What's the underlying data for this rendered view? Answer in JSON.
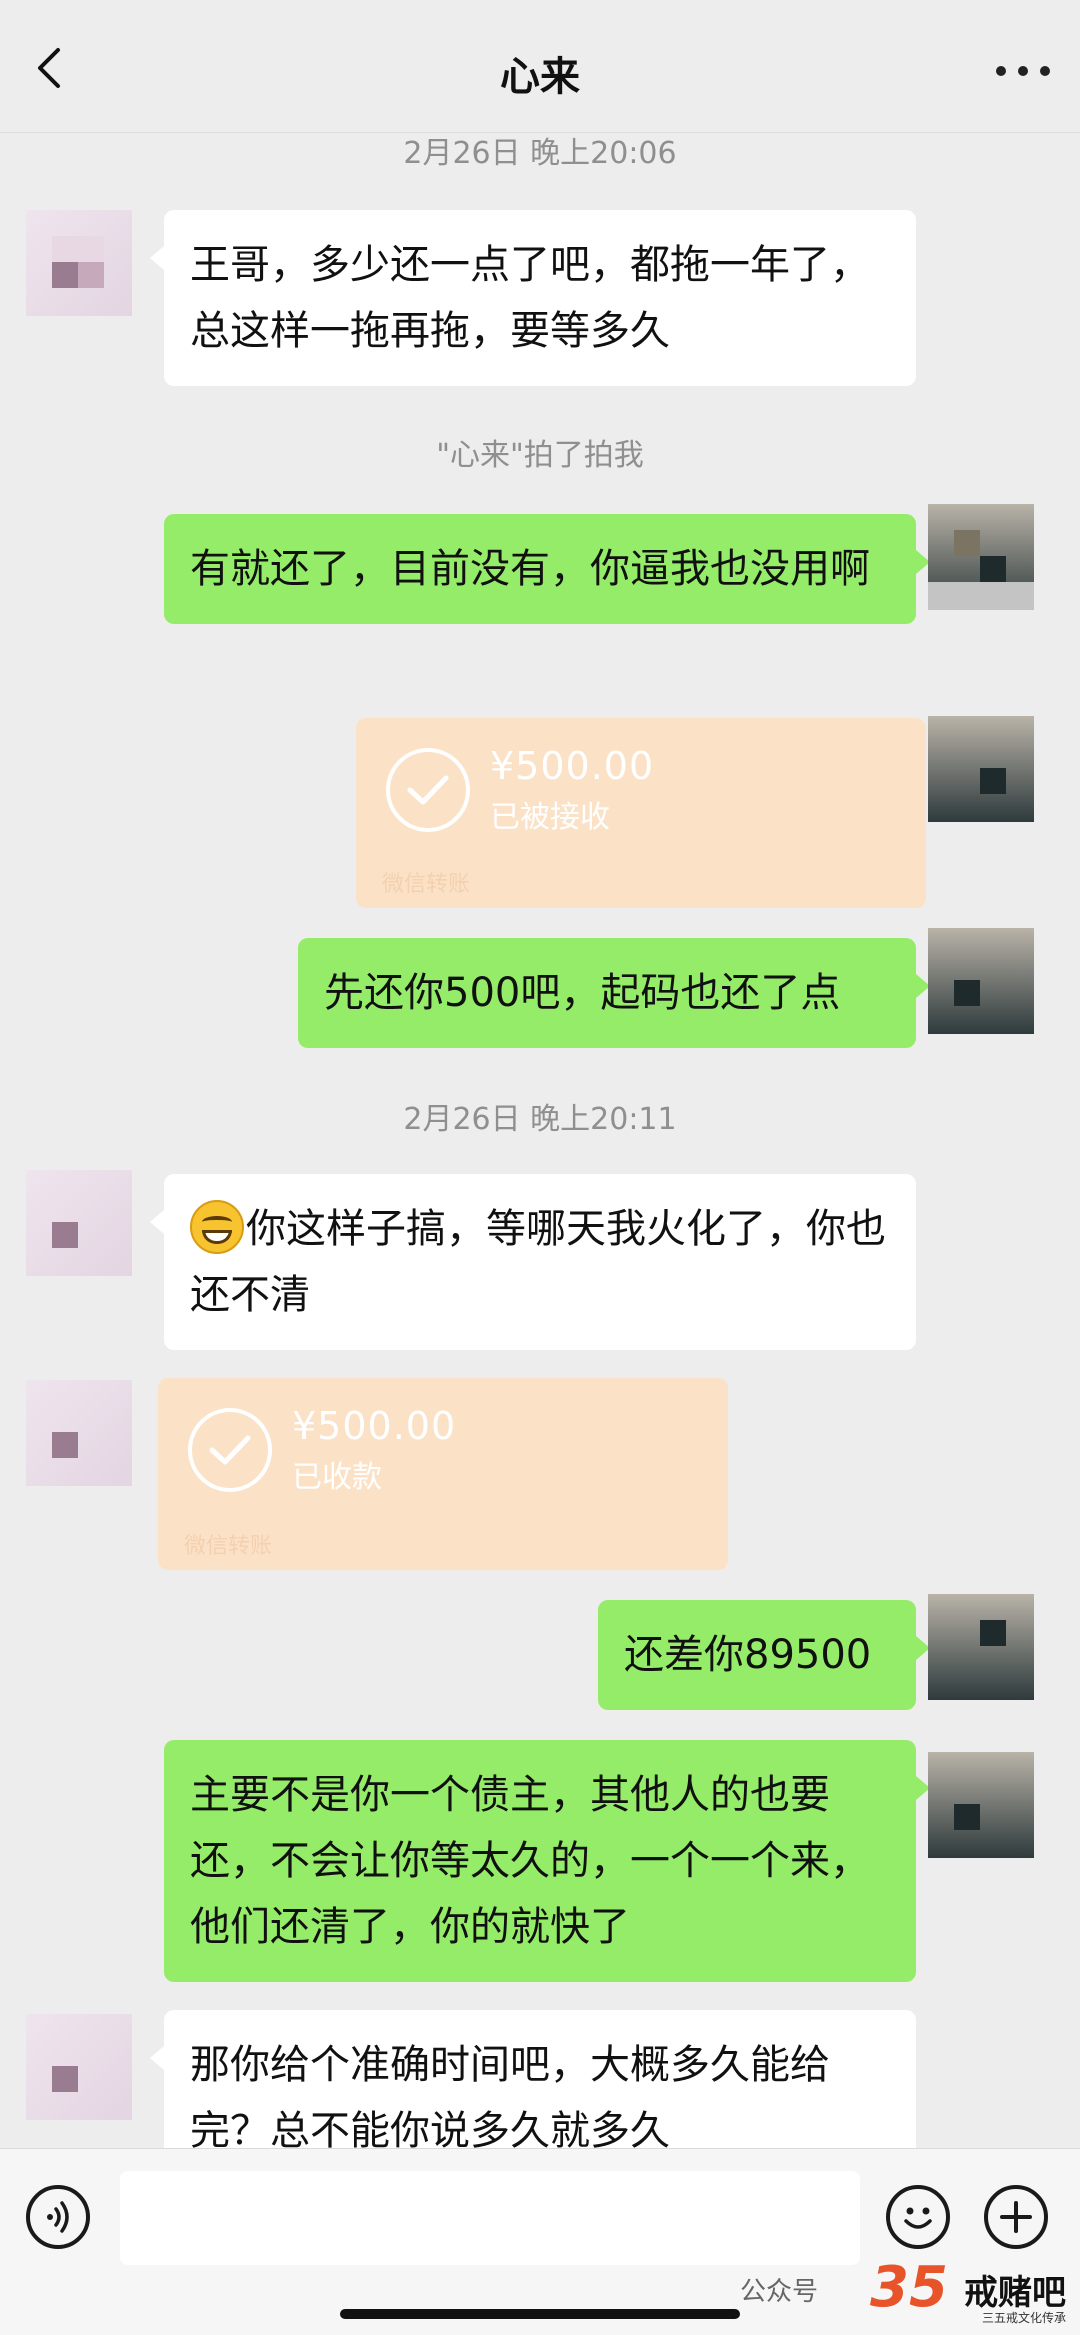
{
  "header": {
    "title": "心来"
  },
  "messages": {
    "time1": "2月26日 晚上20:06",
    "m1": "王哥，多少还一点了吧，都拖一年了，总这样一拖再拖，要等多久",
    "pat": "\"心来\"拍了拍我",
    "m2": "有就还了，目前没有，你逼我也没用啊",
    "transfer1": {
      "amount": "¥500.00",
      "status": "已被接收",
      "foot": "微信转账"
    },
    "m3": "先还你500吧，起码也还了点",
    "time2": "2月26日 晚上20:11",
    "m4": "你这样子搞，等哪天我火化了，你也还不清",
    "transfer2": {
      "amount": "¥500.00",
      "status": "已收款",
      "foot": "微信转账"
    },
    "m5": "还差你89500",
    "m6": "主要不是你一个债主，其他人的也要还，不会让你等太久的，一个一个来，他们还清了，你的就快了",
    "m7": "那你给个准确时间吧，大概多久能给完？总不能你说多久就多久"
  },
  "watermark": {
    "text": "公众号",
    "brand": "戒赌吧",
    "brand_num": "35",
    "brand_sub": "三五戒文化传承"
  },
  "colors": {
    "sent_bubble": "#95ec69",
    "received_bubble": "#ffffff",
    "transfer": "#fbe2c7",
    "background": "#ededed"
  }
}
